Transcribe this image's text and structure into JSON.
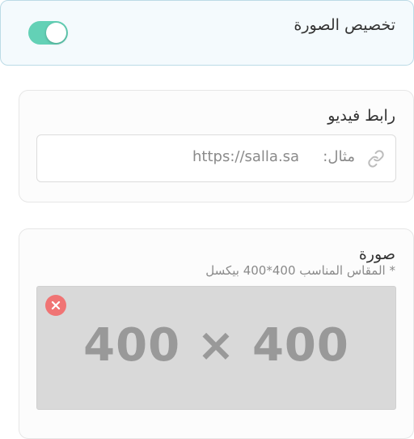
{
  "header": {
    "title": "تخصيص الصورة",
    "toggle_on": true,
    "toggle_color": "#63d1b6"
  },
  "video": {
    "label": "رابط فيديو",
    "placeholder_label": "مثال:",
    "placeholder_value": "https://salla.sa",
    "icon": "link-icon"
  },
  "image": {
    "label": "صورة",
    "hint": "* المقاس المناسب 400*400 بيكسل",
    "preview_text": "400 × 400",
    "remove_icon": "close-icon",
    "remove_color": "#f07474"
  }
}
